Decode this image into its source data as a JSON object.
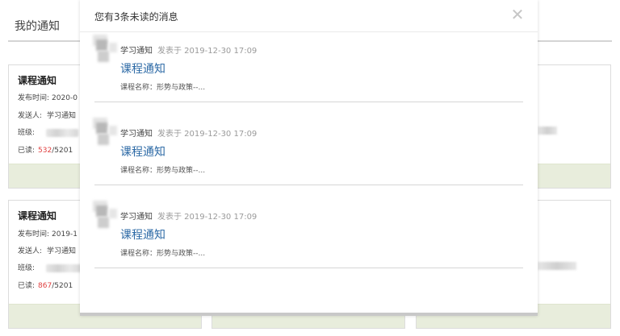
{
  "page": {
    "title": "我的通知"
  },
  "cards": [
    {
      "title": "课程通知",
      "date_label": "发布时间:",
      "date_value": "2020-0",
      "sender_label": "发送人:",
      "sender_value": "学习通知",
      "class_label": "班级:",
      "read_label": "已读:",
      "read_count": "532",
      "read_total": "/5201"
    },
    {
      "title": "课程通知",
      "date_label": "发布时间:",
      "date_value": "2019-1",
      "sender_label": "发送人:",
      "sender_value": "学习通知",
      "class_label": "班级:",
      "read_label": "已读:",
      "read_count": "867",
      "read_total": "/5201"
    }
  ],
  "modal": {
    "title": "您有3条未读的消息",
    "close_icon": "✕",
    "messages": [
      {
        "sender": "学习通知",
        "time": "发表于 2019-12-30 17:09",
        "subject": "课程通知",
        "course": "课程名称：形势与政策--..."
      },
      {
        "sender": "学习通知",
        "time": "发表于 2019-12-30 17:09",
        "subject": "课程通知",
        "course": "课程名称：形势与政策--..."
      },
      {
        "sender": "学习通知",
        "time": "发表于 2019-12-30 17:09",
        "subject": "课程通知",
        "course": "课程名称：形势与政策--..."
      }
    ]
  },
  "colors": {
    "accent_link": "#2d6aa6",
    "read_count": "#e04040",
    "card_footer": "#e8eddc"
  }
}
